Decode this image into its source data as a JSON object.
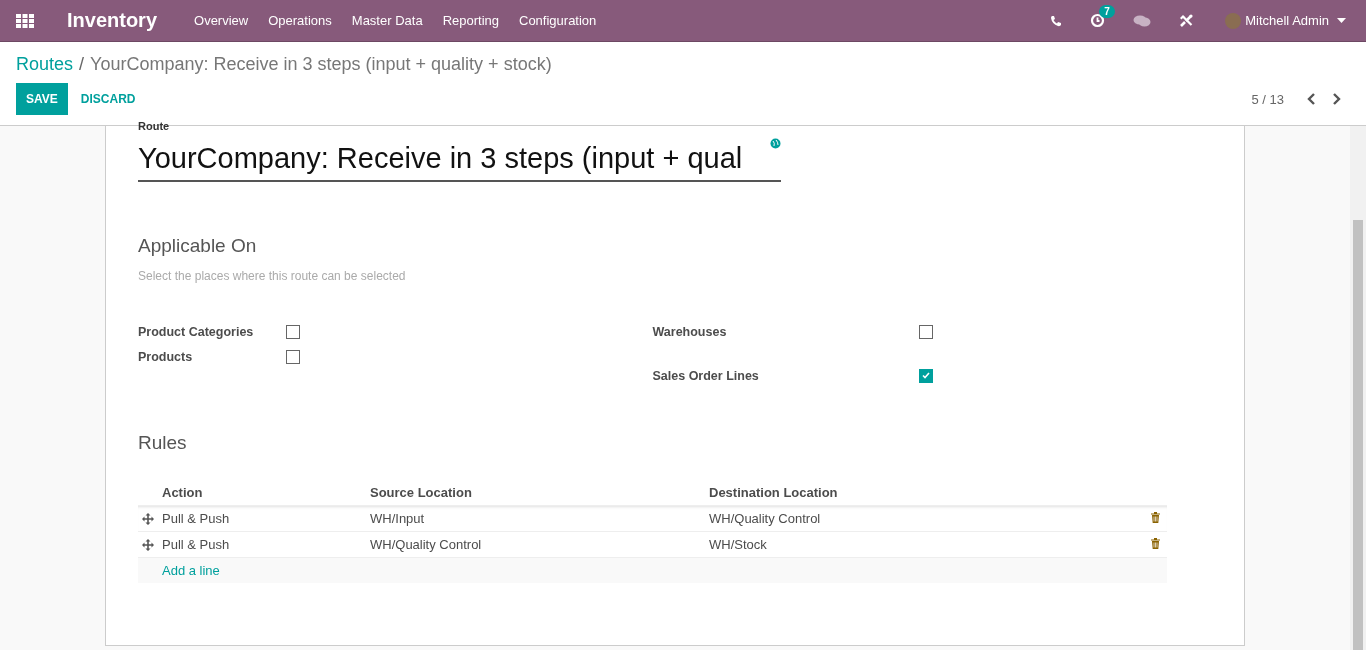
{
  "navbar": {
    "app_name": "Inventory",
    "menus": [
      "Overview",
      "Operations",
      "Master Data",
      "Reporting",
      "Configuration"
    ],
    "activity_count": "7",
    "user": "Mitchell Admin"
  },
  "breadcrumb": {
    "parent": "Routes",
    "separator": "/",
    "current": "YourCompany: Receive in 3 steps (input + quality + stock)"
  },
  "buttons": {
    "save": "SAVE",
    "discard": "DISCARD"
  },
  "pager": "5 / 13",
  "form": {
    "name_label": "Route",
    "name_value": "YourCompany: Receive in 3 steps (input + qual",
    "section_title": "Applicable On",
    "section_help": "Select the places where this route can be selected",
    "applicable_left": [
      {
        "label": "Product Categories",
        "checked": false
      },
      {
        "label": "Products",
        "checked": false
      }
    ],
    "applicable_right": [
      {
        "label": "Warehouses",
        "checked": false
      },
      {
        "label": "Sales Order Lines",
        "checked": true
      }
    ],
    "rules_title": "Rules",
    "columns": [
      "Action",
      "Source Location",
      "Destination Location"
    ],
    "rows": [
      {
        "action": "Pull & Push",
        "source": "WH/Input",
        "destination": "WH/Quality Control"
      },
      {
        "action": "Pull & Push",
        "source": "WH/Quality Control",
        "destination": "WH/Stock"
      }
    ],
    "add_line": "Add a line"
  }
}
